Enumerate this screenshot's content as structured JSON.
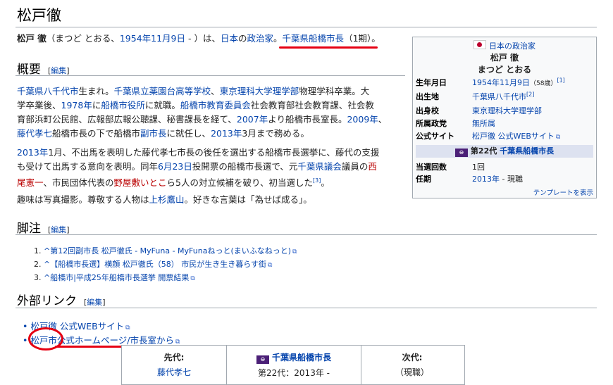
{
  "page": {
    "title": "松戸徹"
  },
  "intro": {
    "name": "松戸 徹",
    "reading": "（まつど とおる、",
    "birth_link": "1954年11月9日",
    "after_birth": " - ）は、",
    "country_link": "日本",
    "no": "の",
    "politician_link": "政治家",
    "sep": "。",
    "mayor_link": "千葉県船橋市長",
    "term": "（1期）",
    "end": "。"
  },
  "sections": {
    "overview": {
      "heading": "概要",
      "edit": "編集"
    },
    "notes": {
      "heading": "脚注",
      "edit": "編集"
    },
    "external": {
      "heading": "外部リンク",
      "edit": "編集"
    }
  },
  "edit_brackets": {
    "open": "[",
    "close": "]"
  },
  "overview_p1": {
    "l1_a": "千葉県八千代市",
    "l1_b": "生まれ。",
    "l1_c": "千葉県立薬園台高等学校",
    "l1_d": "、",
    "l1_e": "東京理科大学理学部",
    "l1_f": "物理学科卒業。大",
    "l2_a": "学卒業後、",
    "l2_b": "1978年",
    "l2_c": "に",
    "l2_d": "船橋市役所",
    "l2_e": "に就職。",
    "l2_f": "船橋市教育委員会",
    "l2_g": "社会教育部社会教育課、社会教",
    "l3_a": "育部浜町公民館、広報部広報公聴課、秘書課長を経て、",
    "l3_b": "2007年",
    "l3_c": "より船橋市長室長。",
    "l3_d": "2009年",
    "l3_e": "、",
    "l4_a": "藤代孝七",
    "l4_b": "船橋市長の下で船橋市",
    "l4_c": "副市長",
    "l4_d": "に就任し、",
    "l4_e": "2013年",
    "l4_f": "3月まで務める。"
  },
  "overview_p2": {
    "l1_a": "2013年",
    "l1_b": "1月、不出馬を表明した藤代孝七市長の後任を選出する船橋市長選挙に、藤代の支援",
    "l2_a": "も受けて出馬する意向を表明。同年",
    "l2_b": "6月23日",
    "l2_c": "投開票の船橋市長選で、元",
    "l2_d": "千葉県議会",
    "l2_e": "議員の",
    "l2_f": "西",
    "l3_a": "尾憲一",
    "l3_b": "、市民団体代表の",
    "l3_c": "野屋敷いとこ",
    "l3_d": "ら5人の対立候補を破り、初当選した",
    "l3_ref": "[3]",
    "l3_e": "。"
  },
  "overview_p3": {
    "a": "趣味は写真撮影。尊敬する人物は",
    "b": "上杉鷹山",
    "c": "。好きな言葉は「為せば成る」。"
  },
  "infobox": {
    "category": "日本の政治家",
    "name": "松戸 徹",
    "reading": "まつど とおる",
    "rows": [
      {
        "key": "生年月日",
        "value": "1954年11月9日",
        "extra": "（58歳）",
        "ref": "[1]"
      },
      {
        "key": "出生地",
        "value": "千葉県八千代市",
        "ref": "[2]"
      },
      {
        "key": "出身校",
        "value": "東京理科大学理学部"
      },
      {
        "key": "所属政党",
        "value": "無所属"
      },
      {
        "key": "公式サイト",
        "value": "松戸徹 公式WEBサイト"
      }
    ],
    "office_num": "第22代",
    "office_title": "千葉県船橋市長",
    "rows2": [
      {
        "key": "当選回数",
        "value": "1回"
      },
      {
        "key": "任期",
        "value": "2013年",
        "extra": " - 現職"
      }
    ],
    "template": "テンプレートを表示",
    "badge": "⊖"
  },
  "references": [
    {
      "num": "1.",
      "caret": "^",
      "text": "第12回副市長 松戸徹氏 - MyFuna - MyFunaねっと(まいふなねっと)"
    },
    {
      "num": "2.",
      "caret": "^",
      "text": "【船橋市長選】横顔 松戸徹氏（58） 市民が生き生き暮らす街"
    },
    {
      "num": "3.",
      "caret": "^",
      "text": "船橋市|平成25年船橋市長選挙 開票結果"
    }
  ],
  "external_links": [
    {
      "text": "松戸徹 公式WEBサイト"
    },
    {
      "text": "松戸市公式ホームページ/市長室から"
    }
  ],
  "succession": {
    "prev_label": "先代:",
    "prev_name": "藤代孝七",
    "office": "千葉県船橋市長",
    "term": "第22代：2013年 -",
    "next_label": "次代:",
    "next_name": "（現職）"
  },
  "colors": {
    "link": "#0645ad",
    "redlink": "#ba0000",
    "annotation": "#e60012"
  }
}
